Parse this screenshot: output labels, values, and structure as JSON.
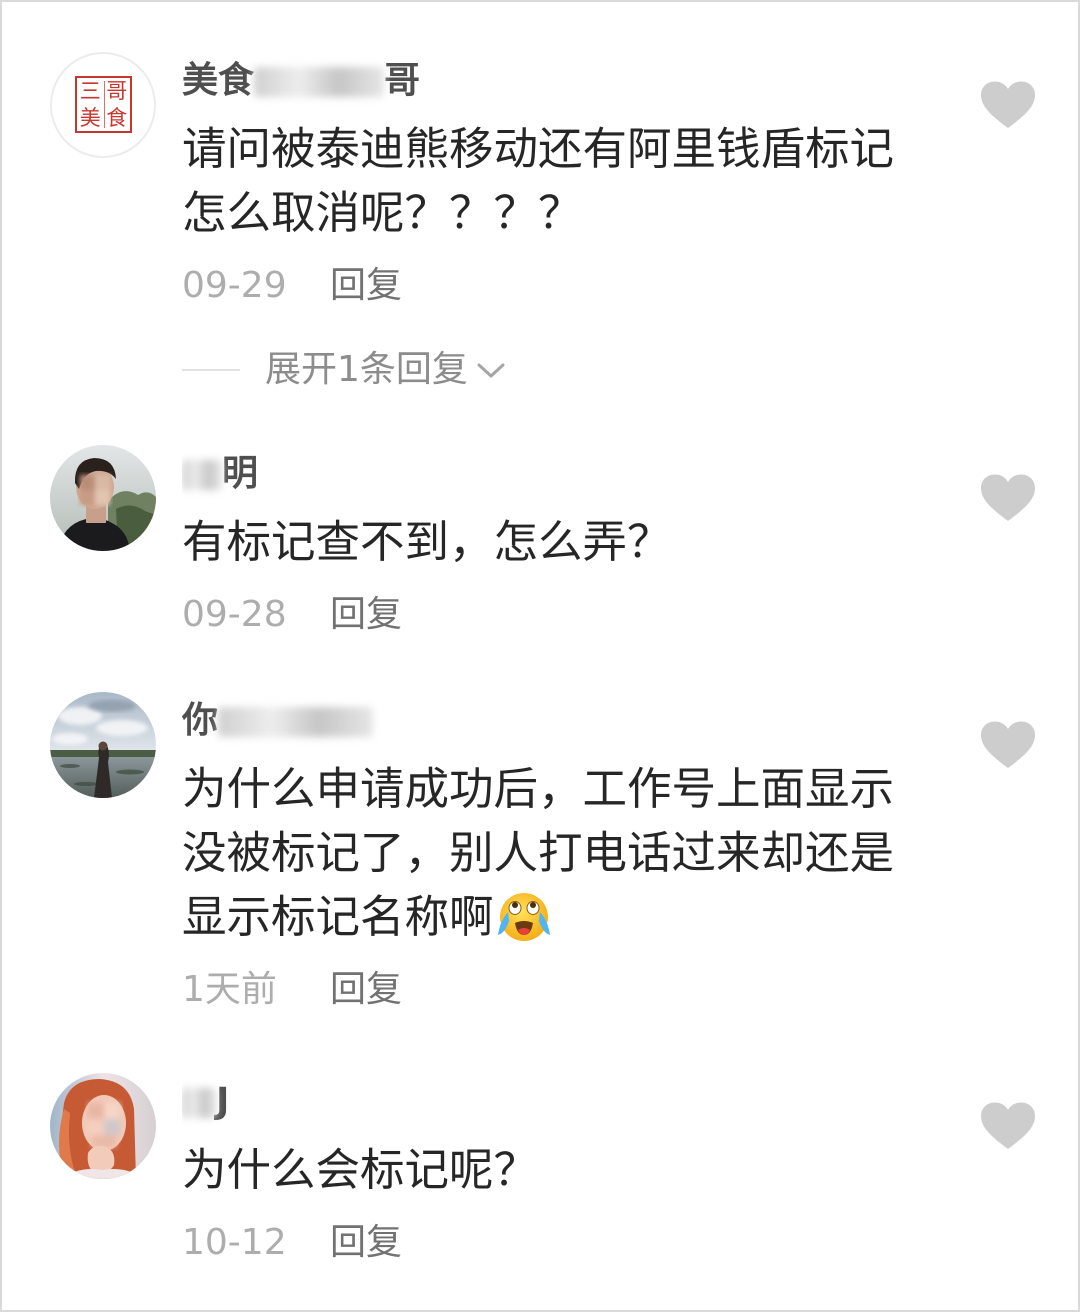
{
  "theme": {
    "background": "#ffffff",
    "text": "#262626",
    "author": "#4f4f4f",
    "date": "#adadad",
    "reply": "#727272",
    "like": "#cdcdcd",
    "seal": "#c8372d"
  },
  "comments": [
    {
      "author": {
        "prefix": "美食",
        "suffix": "哥"
      },
      "avatar": {
        "seal_chars": [
          "三",
          "哥",
          "美",
          "食"
        ]
      },
      "text_lines": [
        "请问被泰迪熊移动还有阿里钱盾标记",
        "怎么取消呢？？？？"
      ],
      "date": "09-29",
      "reply_label": "回复",
      "like_icon": "heart-icon",
      "expand_replies": {
        "label": "展开1条回复",
        "icon": "chevron-down-icon"
      }
    },
    {
      "author": {
        "suffix": "明"
      },
      "text_lines": [
        "有标记查不到，怎么弄？"
      ],
      "date": "09-28",
      "reply_label": "回复",
      "like_icon": "heart-icon"
    },
    {
      "author": {
        "prefix": "你"
      },
      "text_lines": [
        "为什么申请成功后，工作号上面显示",
        "没被标记了，别人打电话过来却还是",
        "显示标记名称啊"
      ],
      "trailing_emoji": "crying-laughing-face-icon",
      "date": "1天前",
      "reply_label": "回复",
      "like_icon": "heart-icon"
    },
    {
      "author": {
        "suffix": "J"
      },
      "text_lines": [
        "为什么会标记呢？"
      ],
      "date": "10-12",
      "reply_label": "回复",
      "like_icon": "heart-icon"
    }
  ]
}
